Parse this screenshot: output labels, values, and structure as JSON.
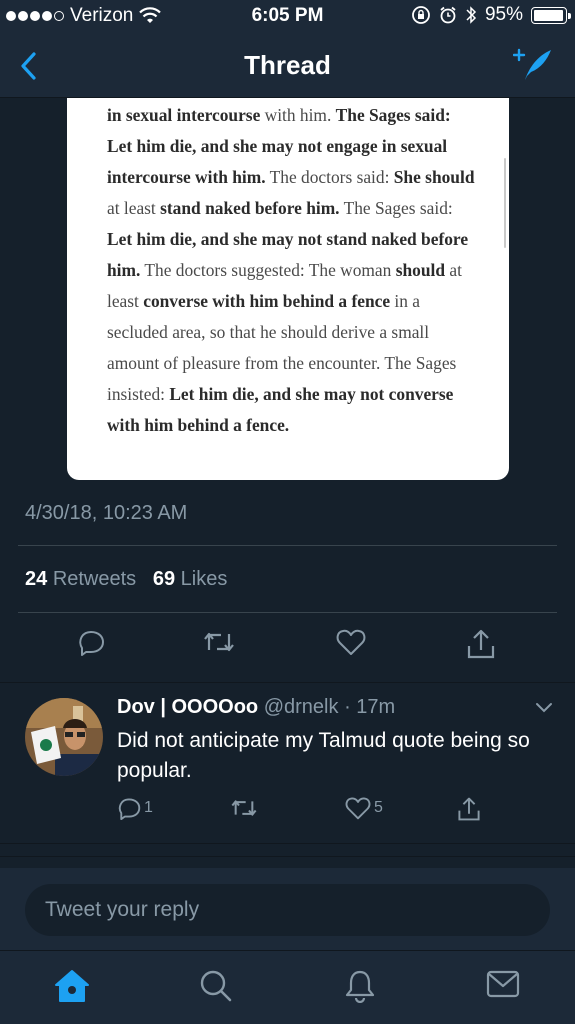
{
  "status_bar": {
    "carrier": "Verizon",
    "time": "6:05 PM",
    "battery": "95%",
    "battery_level": 0.95
  },
  "nav": {
    "title": "Thread",
    "back_icon": "chevron-left-icon",
    "compose_icon": "compose-tweet-icon"
  },
  "tweet": {
    "image_text": [
      {
        "t": "in sexual intercourse",
        "b": true
      },
      {
        "t": " with him. ",
        "b": false
      },
      {
        "t": "The Sages said: Let him die, and she may not engage in sexual intercourse with him.",
        "b": true
      },
      {
        "t": " The doctors said: ",
        "b": false
      },
      {
        "t": "She should",
        "b": true
      },
      {
        "t": " at least ",
        "b": false
      },
      {
        "t": "stand naked before him.",
        "b": true
      },
      {
        "t": " The Sages said: ",
        "b": false
      },
      {
        "t": "Let him die, and she may not stand naked before him.",
        "b": true
      },
      {
        "t": " The doctors suggested: The woman ",
        "b": false
      },
      {
        "t": "should",
        "b": true
      },
      {
        "t": " at least ",
        "b": false
      },
      {
        "t": "converse with him behind a fence",
        "b": true
      },
      {
        "t": " in a secluded area, so that he should derive a small amount of pleasure from the encounter. The Sages insisted: ",
        "b": false
      },
      {
        "t": "Let him die, and she may not converse with him behind a fence.",
        "b": true
      }
    ],
    "timestamp": "4/30/18, 10:23 AM",
    "retweets_count": "24",
    "retweets_label": "Retweets",
    "likes_count": "69",
    "likes_label": "Likes"
  },
  "reply": {
    "display_name": "Dov | OOOOoo",
    "handle": "@drnelk",
    "time": "· 17m",
    "text": "Did not anticipate my Talmud quote being so popular.",
    "reply_count": "1",
    "like_count": "5"
  },
  "composer": {
    "placeholder": "Tweet your reply"
  },
  "tabs": [
    "home-icon",
    "search-icon",
    "notifications-icon",
    "messages-icon"
  ],
  "colors": {
    "accent": "#1da1f2",
    "background": "#15202b",
    "bar": "#1c2938",
    "muted": "#8899a6"
  }
}
